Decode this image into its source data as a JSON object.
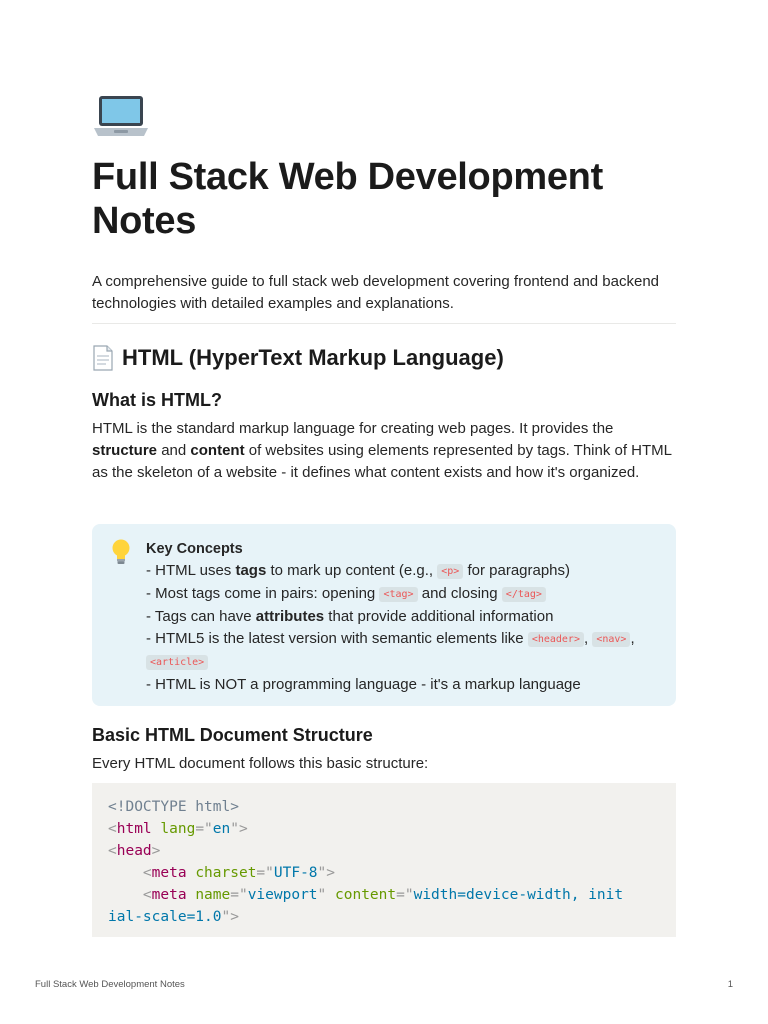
{
  "page": {
    "icon": "laptop-icon",
    "title": "Full Stack Web Development Notes",
    "intro": "A comprehensive guide to full stack web development covering frontend and backend technologies with detailed examples and explanations."
  },
  "section_html": {
    "icon": "page-facing-up-icon",
    "heading": "HTML (HyperText Markup Language)",
    "what_heading": "What is HTML?",
    "what_para": {
      "t1": "HTML is the standard markup language for creating web pages. It provides the ",
      "b1": "structure",
      "t2": " and ",
      "b2": "content",
      "t3": " of websites using elements represented by tags. Think of HTML as the skeleton of a website - it defines what content exists and how it's organized."
    },
    "callout": {
      "icon": "light-bulb-icon",
      "title": "Key Concepts",
      "line1": {
        "a": "- HTML uses ",
        "b": "tags",
        "c": " to mark up content (e.g., ",
        "code": "<p>",
        "d": " for paragraphs)"
      },
      "line2": {
        "a": "- Most tags come in pairs: opening ",
        "code1": "<tag>",
        "b": " and closing ",
        "code2": "</tag>"
      },
      "line3": {
        "a": "- Tags can have ",
        "b": "attributes",
        "c": " that provide additional information"
      },
      "line4": {
        "a": "- HTML5 is the latest version with semantic elements like ",
        "code1": "<header>",
        "sep1": ", ",
        "code2": "<nav>",
        "sep2": ", ",
        "code3": "<article>"
      },
      "line5": "- HTML is NOT a programming language - it's a markup language"
    },
    "structure_heading": "Basic HTML Document Structure",
    "structure_sub": "Every HTML document follows this basic structure:",
    "code": {
      "l1": "<!DOCTYPE html>",
      "l2": {
        "open": "<",
        "tag": "html",
        "attr": "lang",
        "eq": "=\"",
        "val": "en",
        "close": "\">"
      },
      "l3": {
        "open": "<",
        "tag": "head",
        "close": ">"
      },
      "l4": {
        "indent": "    ",
        "open": "<",
        "tag": "meta",
        "attr": "charset",
        "eq": "=\"",
        "val": "UTF-8",
        "close": "\">"
      },
      "l5": {
        "indent": "    ",
        "open": "<",
        "tag": "meta",
        "attr1": "name",
        "eq1": "=\"",
        "val1": "viewport",
        "q1": "\"",
        "attr2": "content",
        "eq2": "=\"",
        "val2a": "width=device-width, init"
      },
      "l6": {
        "val2b": "ial-scale=1.0",
        "close": "\">"
      }
    }
  },
  "footer": {
    "left": "Full Stack Web Development Notes",
    "right": "1"
  }
}
